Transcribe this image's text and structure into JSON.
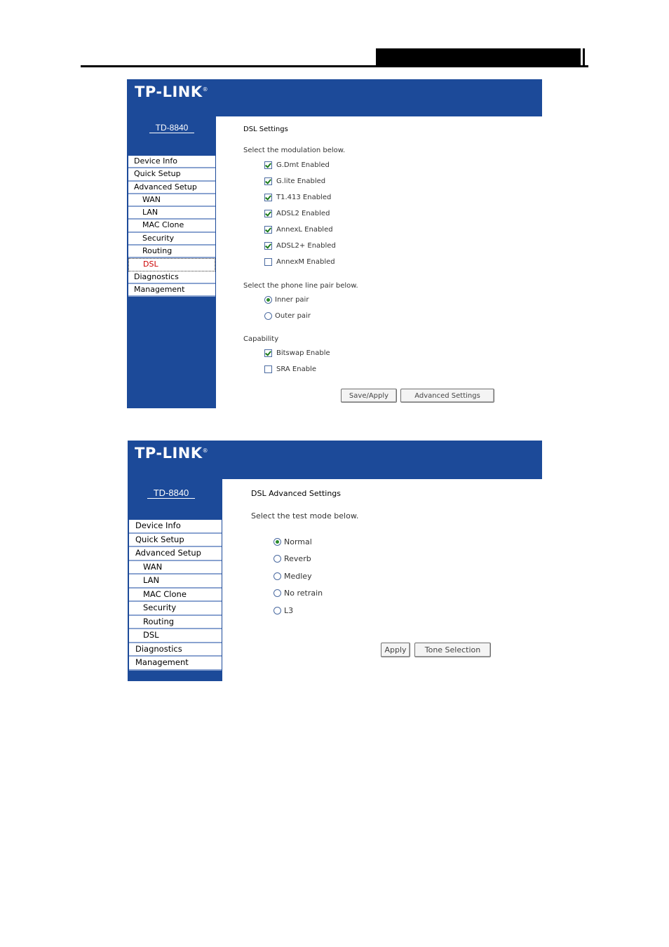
{
  "brand": {
    "logo_text": "TP-LINK",
    "logo_mark": "®",
    "model": "TD-8840"
  },
  "colors": {
    "banner": "#1c4a99",
    "active_menu": "#cc0000"
  },
  "menu": {
    "items": [
      {
        "label": "Device Info",
        "sub": false
      },
      {
        "label": "Quick Setup",
        "sub": false
      },
      {
        "label": "Advanced Setup",
        "sub": false
      },
      {
        "label": "WAN",
        "sub": true
      },
      {
        "label": "LAN",
        "sub": true
      },
      {
        "label": "MAC Clone",
        "sub": true
      },
      {
        "label": "Security",
        "sub": true
      },
      {
        "label": "Routing",
        "sub": true
      },
      {
        "label": "DSL",
        "sub": true
      },
      {
        "label": "Diagnostics",
        "sub": false
      },
      {
        "label": "Management",
        "sub": false
      }
    ],
    "active_index_panel1": 8
  },
  "panel1": {
    "title": "DSL Settings",
    "modulation_prompt": "Select the modulation below.",
    "modulations": [
      {
        "label": "G.Dmt Enabled",
        "checked": true
      },
      {
        "label": "G.lite Enabled",
        "checked": true
      },
      {
        "label": "T1.413 Enabled",
        "checked": true
      },
      {
        "label": "ADSL2 Enabled",
        "checked": true
      },
      {
        "label": "AnnexL Enabled",
        "checked": true
      },
      {
        "label": "ADSL2+ Enabled",
        "checked": true
      },
      {
        "label": "AnnexM Enabled",
        "checked": false
      }
    ],
    "phone_prompt": "Select the phone line pair below.",
    "phone_pairs": [
      {
        "label": "Inner pair",
        "checked": true
      },
      {
        "label": "Outer pair",
        "checked": false
      }
    ],
    "capability_label": "Capability",
    "capabilities": [
      {
        "label": "Bitswap Enable",
        "checked": true
      },
      {
        "label": "SRA Enable",
        "checked": false
      }
    ],
    "save_button": "Save/Apply",
    "advanced_button": "Advanced Settings"
  },
  "panel2": {
    "title": "DSL Advanced Settings",
    "test_prompt": "Select the test mode below.",
    "test_modes": [
      {
        "label": "Normal",
        "checked": true
      },
      {
        "label": "Reverb",
        "checked": false
      },
      {
        "label": "Medley",
        "checked": false
      },
      {
        "label": "No retrain",
        "checked": false
      },
      {
        "label": "L3",
        "checked": false
      }
    ],
    "apply_button": "Apply",
    "tone_button": "Tone Selection"
  }
}
